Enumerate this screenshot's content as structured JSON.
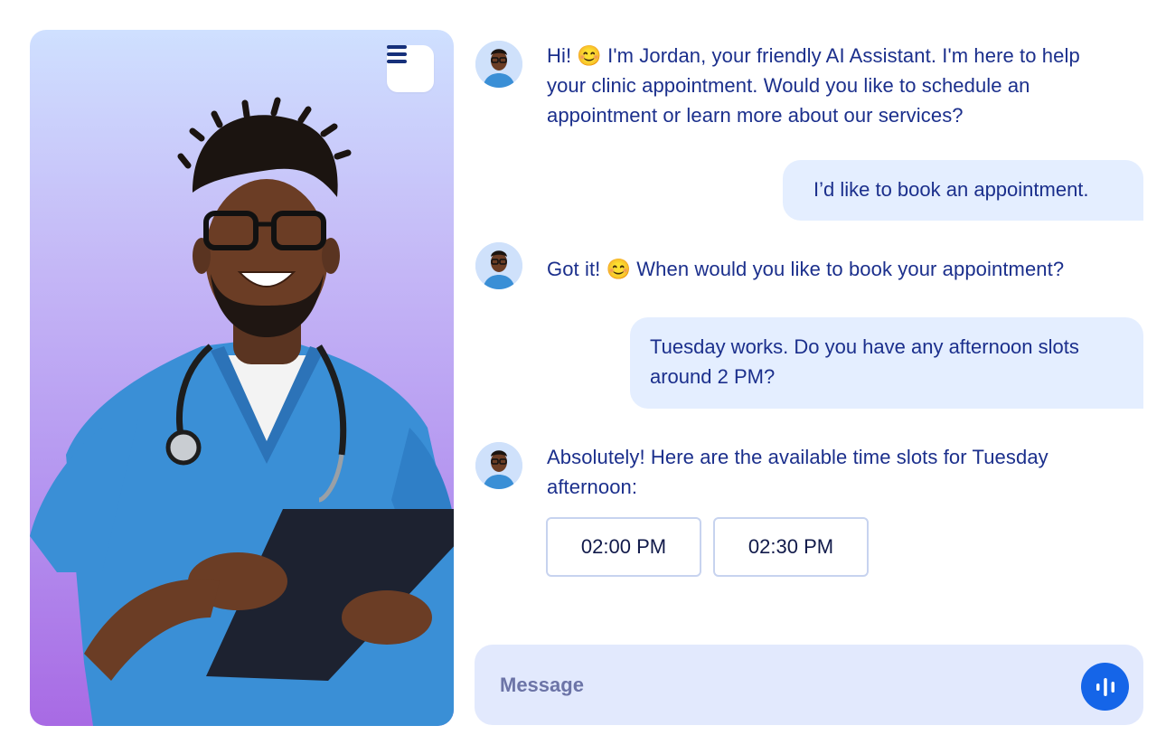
{
  "assistant": {
    "name": "Jordan"
  },
  "messages": [
    {
      "role": "assistant",
      "lines": [
        "Hi! 😊 I'm Jordan, your friendly AI Assistant. I'm here to help",
        "your clinic appointment. Would you like to schedule an",
        "appointment or learn more about our services?"
      ]
    },
    {
      "role": "user",
      "lines": [
        "I’d like to book an appointment."
      ]
    },
    {
      "role": "assistant",
      "lines": [
        "Got it! 😊 When would you like to book your appointment?"
      ]
    },
    {
      "role": "user",
      "lines": [
        "Tuesday works. Do you have any afternoon slots",
        "around 2 PM?"
      ]
    },
    {
      "role": "assistant",
      "lines": [
        "Absolutely! Here are the available time slots for Tuesday",
        "afternoon:"
      ]
    }
  ],
  "time_slots": [
    "02:00 PM",
    "02:30 PM"
  ],
  "composer": {
    "placeholder": "Message"
  },
  "icons": {
    "menu": "hamburger-menu-icon",
    "voice": "voice-waveform-icon",
    "emoji": "smiling-face-icon"
  },
  "colors": {
    "accent": "#1565e8",
    "text": "#1b2f8c",
    "user_bubble": "#e4eeff",
    "composer_bg": "#e2e9fd"
  }
}
